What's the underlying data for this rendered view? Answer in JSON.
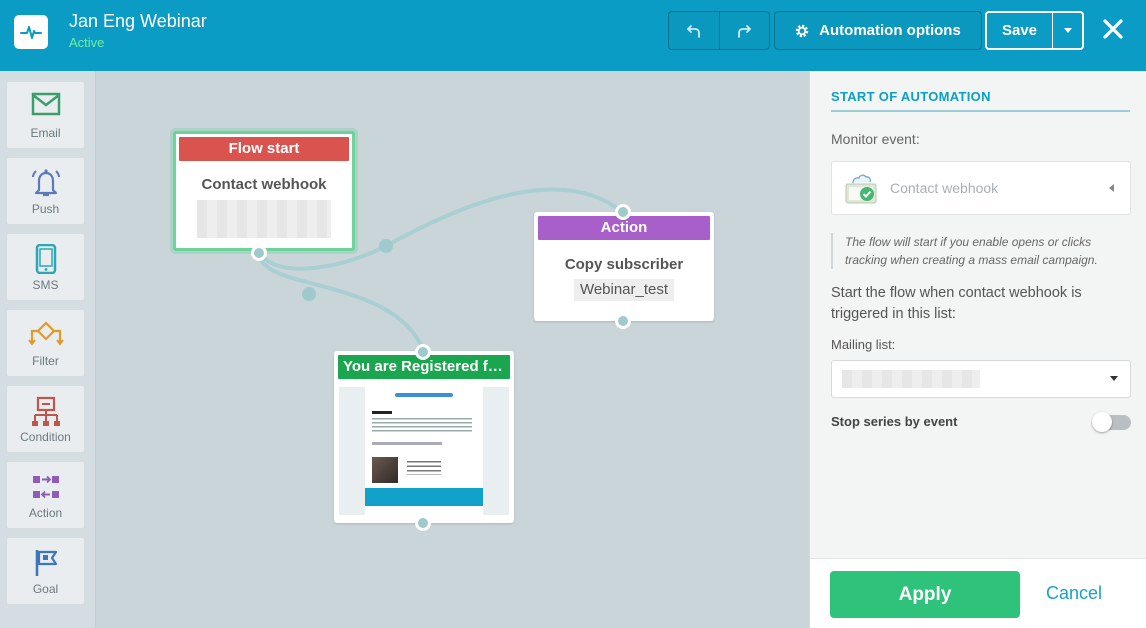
{
  "header": {
    "title": "Jan Eng Webinar",
    "status": "Active",
    "automation_options_label": "Automation options",
    "save_label": "Save",
    "colors": {
      "bar": "#0a9cc4",
      "status": "#6ff0a0"
    }
  },
  "palette": {
    "items": [
      {
        "label": "Email",
        "icon": "envelope-icon"
      },
      {
        "label": "Push",
        "icon": "bell-icon"
      },
      {
        "label": "SMS",
        "icon": "phone-icon"
      },
      {
        "label": "Filter",
        "icon": "filter-icon"
      },
      {
        "label": "Condition",
        "icon": "condition-icon"
      },
      {
        "label": "Action",
        "icon": "action-icon"
      },
      {
        "label": "Goal",
        "icon": "flag-icon"
      }
    ]
  },
  "canvas": {
    "flow_start": {
      "header": "Flow start",
      "title": "Contact webhook",
      "color": "#d9534f"
    },
    "action": {
      "header": "Action",
      "title": "Copy subscriber",
      "tag": "Webinar_test",
      "color": "#a85fc9"
    },
    "email": {
      "header": "You are Registered fo...",
      "color": "#1aa64f"
    }
  },
  "panel": {
    "title": "START OF AUTOMATION",
    "monitor_label": "Monitor event:",
    "event_value": "Contact webhook",
    "hint": "The flow will start if you enable opens or clicks tracking when creating a mass email campaign.",
    "start_text": "Start the flow when contact webhook is triggered in this list:",
    "mailing_list_label": "Mailing list:",
    "stop_label": "Stop series by event",
    "apply_label": "Apply",
    "cancel_label": "Cancel",
    "colors": {
      "accent": "#0aa0c8",
      "apply": "#2fc27a"
    }
  }
}
